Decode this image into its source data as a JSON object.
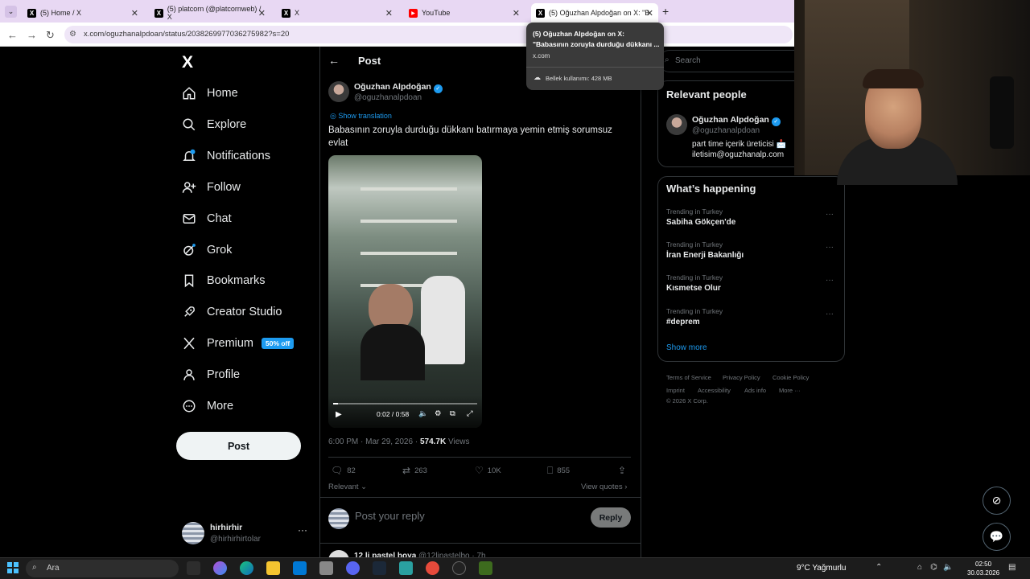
{
  "browser": {
    "tabs": [
      {
        "title": "(5) Home / X",
        "icon": "x-logo-icon"
      },
      {
        "title": "(5) platcorn (@platcornweb) / X",
        "icon": "x-logo-icon"
      },
      {
        "title": "X",
        "icon": "x-logo-icon"
      },
      {
        "title": "YouTube",
        "icon": "youtube-icon"
      },
      {
        "title": "(5) Oğuzhan Alpdoğan on X: \"B",
        "icon": "x-logo-icon",
        "active": true
      }
    ],
    "new_tab_symbol": "+",
    "url": "x.com/oguzhanalpdoan/status/2038269977036275982?s=20",
    "tooltip": {
      "title": "(5) Oğuzhan Alpdoğan on X: \"Babasının zoruyla durduğu dükkanı ...",
      "domain": "x.com",
      "memory": "Bellek kullanımı: 428 MB"
    }
  },
  "sidebar": {
    "logo": "X",
    "items": [
      {
        "label": "Home",
        "icon": "home-icon"
      },
      {
        "label": "Explore",
        "icon": "search-icon"
      },
      {
        "label": "Notifications",
        "icon": "bell-icon",
        "badge": "5"
      },
      {
        "label": "Follow",
        "icon": "follow-icon"
      },
      {
        "label": "Chat",
        "icon": "mail-icon"
      },
      {
        "label": "Grok",
        "icon": "grok-icon"
      },
      {
        "label": "Bookmarks",
        "icon": "bookmark-icon"
      },
      {
        "label": "Creator Studio",
        "icon": "rocket-icon"
      },
      {
        "label": "Premium",
        "icon": "x-logo-icon"
      },
      {
        "label": "Profile",
        "icon": "person-icon"
      },
      {
        "label": "More",
        "icon": "more-circle-icon"
      }
    ],
    "premium_badge": "50% off",
    "post_button": "Post",
    "account": {
      "name": "hirhirhir",
      "handle": "@hirhirhirtolar",
      "more": "···"
    }
  },
  "post": {
    "header": "Post",
    "author_name": "Oğuzhan Alpdoğan",
    "author_handle": "@oguzhanalpdoan",
    "show_translation": "Show translation",
    "text": "Babasının zoruyla durduğu dükkanı batırmaya yemin etmiş sorumsuz evlat",
    "video": {
      "time": "0:02 / 0:58",
      "progress": 0.035
    },
    "meta_time": "6:00 PM · Mar 29, 2026 · ",
    "views_count": "574.7K",
    "views_label": " Views",
    "actions": {
      "replies": "82",
      "reposts": "263",
      "likes": "10K",
      "bookmarks": "855"
    },
    "sort_label": "Relevant",
    "view_quotes": "View quotes",
    "reply_placeholder": "Post your reply",
    "reply_button": "Reply",
    "next_reply_name": "12 li pastel boya",
    "next_reply_handle": "@12lipastelbo · 7h"
  },
  "right": {
    "search_placeholder": "Search",
    "relevant_title": "Relevant people",
    "relevant_person": {
      "name": "Oğuzhan Alpdoğan",
      "handle": "@oguzhanalpdoan",
      "bio": "part time içerik üreticisi 📩 iletisim@oguzhanalp.com"
    },
    "happening_title": "What’s happening",
    "trends": [
      {
        "category": "Trending in Turkey",
        "name": "Sabiha Gökçen'de"
      },
      {
        "category": "Trending in Turkey",
        "name": "İran Enerji Bakanlığı"
      },
      {
        "category": "Trending in Turkey",
        "name": "Kısmetse Olur"
      },
      {
        "category": "Trending in Turkey",
        "name": "#deprem"
      }
    ],
    "show_more": "Show more",
    "footer": [
      "Terms of Service",
      "Privacy Policy",
      "Cookie Policy",
      "Imprint",
      "Accessibility",
      "Ads info",
      "More ···",
      "© 2026 X Corp."
    ]
  },
  "taskbar": {
    "search_placeholder": "Ara",
    "weather": "9°C  Yağmurlu",
    "time": "02:50",
    "date": "30.03.2026"
  }
}
